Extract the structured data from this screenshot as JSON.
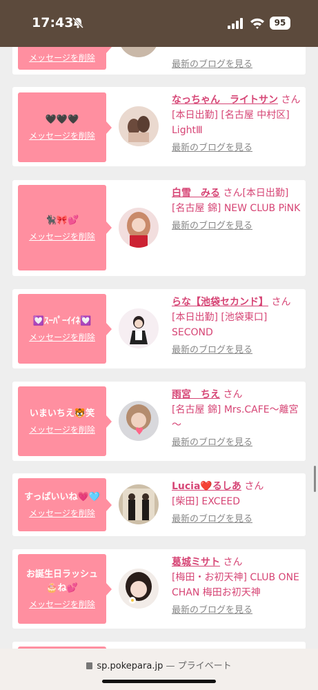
{
  "status_bar": {
    "time": "17:43",
    "battery": "95"
  },
  "common": {
    "delete_label": "メッセージを削除",
    "blog_label": "最新のブログを見る",
    "san": "さん"
  },
  "cards": [
    {
      "message": "",
      "name": "",
      "info": ""
    },
    {
      "message": "🖤🖤🖤",
      "name": "なっちゃん　ライトサン",
      "info": "[本日出勤] [名古屋 中村区] LightⅢ"
    },
    {
      "message": "🐈‍⬛🎀💕",
      "name": "白雪　みる",
      "info": "[本日出勤] [名古屋 錦] NEW CLUB PiNK"
    },
    {
      "message": "💟ｽｰﾊﾟｰｲｲﾈ💟",
      "name": "らな【池袋セカンド】",
      "info": "[本日出勤] [池袋東口] SECOND"
    },
    {
      "message": "いまいちえ🐯笑",
      "name": "雨宮　ちえ",
      "info": "[名古屋 錦] Mrs.CAFE～離宮～"
    },
    {
      "message": "すっぱいいね💗🩵",
      "name": "Lucia❤️るしあ",
      "info": "[柴田] EXCEED"
    },
    {
      "message": "お誕生日ラッシュ🎂ね💕",
      "name": "葛城ミサト",
      "info": "[梅田・お初天神] CLUB ONE CHAN 梅田お初天神"
    }
  ],
  "url_bar": {
    "domain": "sp.pokepara.jp",
    "separator": " — ",
    "mode": "プライベート"
  },
  "colors": {
    "status_bg": "#5c4a3c",
    "pink": "#ff8fa0",
    "name_pink": "#d64575",
    "card_bg": "#ffffff",
    "page_bg": "#eeeeee"
  }
}
